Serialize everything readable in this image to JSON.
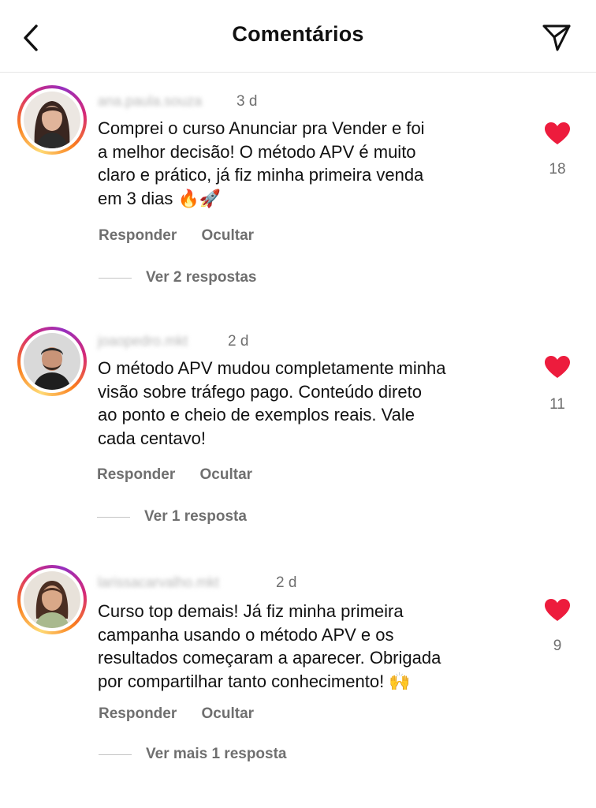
{
  "header": {
    "title": "Comentários",
    "back_icon": "chevron-left-icon",
    "share_icon": "paper-plane-icon"
  },
  "colors": {
    "heart": "#ed1c3d",
    "secondary_text": "#6f6f6f",
    "primary_text": "#111111"
  },
  "comments": [
    {
      "username": "ana.paula.souza",
      "time": "3 d",
      "text_lines": [
        "Comprei o curso Anunciar pra Vender e foi",
        "a melhor decisão! O método APV é muito",
        "claro e prático, já fiz minha primeira venda",
        "em 3 dias 🔥🚀"
      ],
      "likes": "18",
      "reply_label": "Responder",
      "hide_label": "Ocultar",
      "view_replies": "Ver 2 respostas"
    },
    {
      "username": "joaopedro.mkt",
      "time": "2 d",
      "text_lines": [
        "O método APV mudou completamente minha",
        "visão sobre tráfego pago. Conteúdo direto",
        "ao ponto e cheio de exemplos reais. Vale",
        "cada centavo!"
      ],
      "likes": "11",
      "reply_label": "Responder",
      "hide_label": "Ocultar",
      "view_replies": "Ver 1 resposta"
    },
    {
      "username": "larissacarvalho.mkt",
      "time": "2 d",
      "text_lines": [
        "Curso top demais! Já fiz minha primeira",
        "campanha usando o método APV e os",
        "resultados começaram a aparecer. Obrigada",
        "por compartilhar tanto conhecimento! 🙌"
      ],
      "likes": "9",
      "reply_label": "Responder",
      "hide_label": "Ocultar",
      "view_replies": "Ver mais 1 resposta"
    }
  ]
}
